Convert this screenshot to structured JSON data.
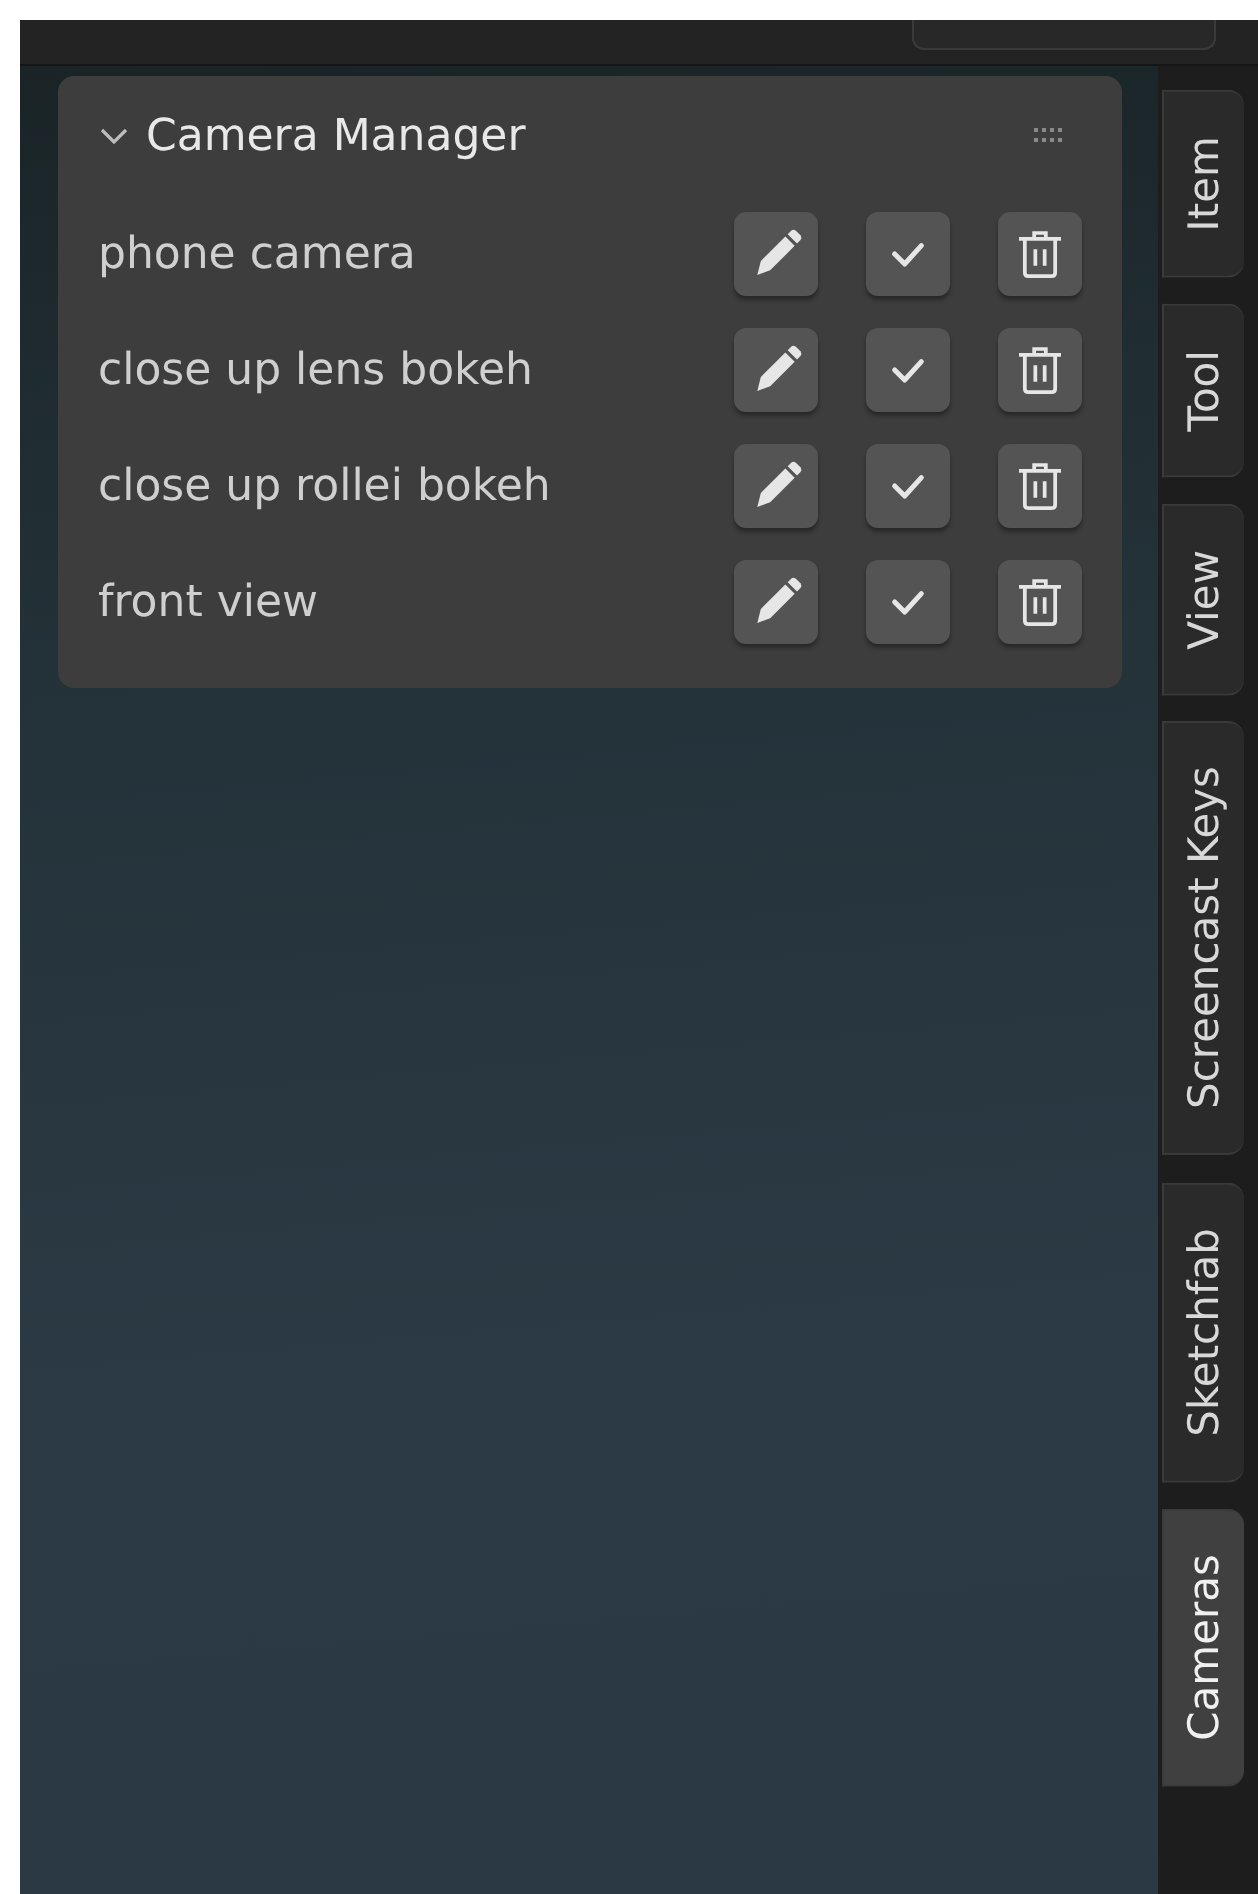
{
  "panel": {
    "title": "Camera Manager",
    "expanded": true,
    "cameras": [
      {
        "name": "phone camera"
      },
      {
        "name": "close up lens bokeh"
      },
      {
        "name": "close up rollei bokeh"
      },
      {
        "name": "front view"
      }
    ]
  },
  "tabs": [
    {
      "label": "Item",
      "selected": false
    },
    {
      "label": "Tool",
      "selected": false
    },
    {
      "label": "View",
      "selected": false
    },
    {
      "label": "Screencast Keys",
      "selected": false
    },
    {
      "label": "Sketchfab",
      "selected": false
    },
    {
      "label": "Cameras",
      "selected": true
    }
  ]
}
